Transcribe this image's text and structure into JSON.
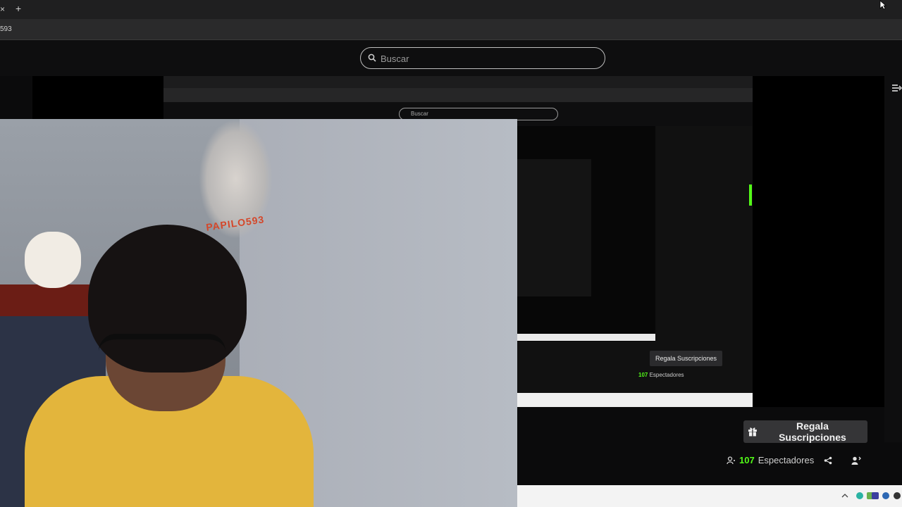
{
  "browser": {
    "tab_close": "×",
    "tab_new": "+",
    "address_text": "593"
  },
  "header": {
    "search_placeholder": "Buscar"
  },
  "recursion": {
    "search_placeholder": "Buscar",
    "gift_label": "Regala Suscripciones",
    "viewer_count": "107",
    "viewer_label": "Espectadores"
  },
  "webcam": {
    "sticker_text": "PAPILO593"
  },
  "stream_actions": {
    "gift_label": "Regala Suscripciones",
    "viewer_count": "107",
    "viewer_label": "Espectadores"
  },
  "colors": {
    "accent": "#53fc18",
    "background": "#0b0b0c",
    "button_bg": "#353537"
  },
  "icons": [
    "close-icon",
    "plus-icon",
    "search-icon",
    "gift-icon",
    "viewers-icon",
    "share-icon",
    "follow-icon",
    "collapse-panel-icon"
  ]
}
